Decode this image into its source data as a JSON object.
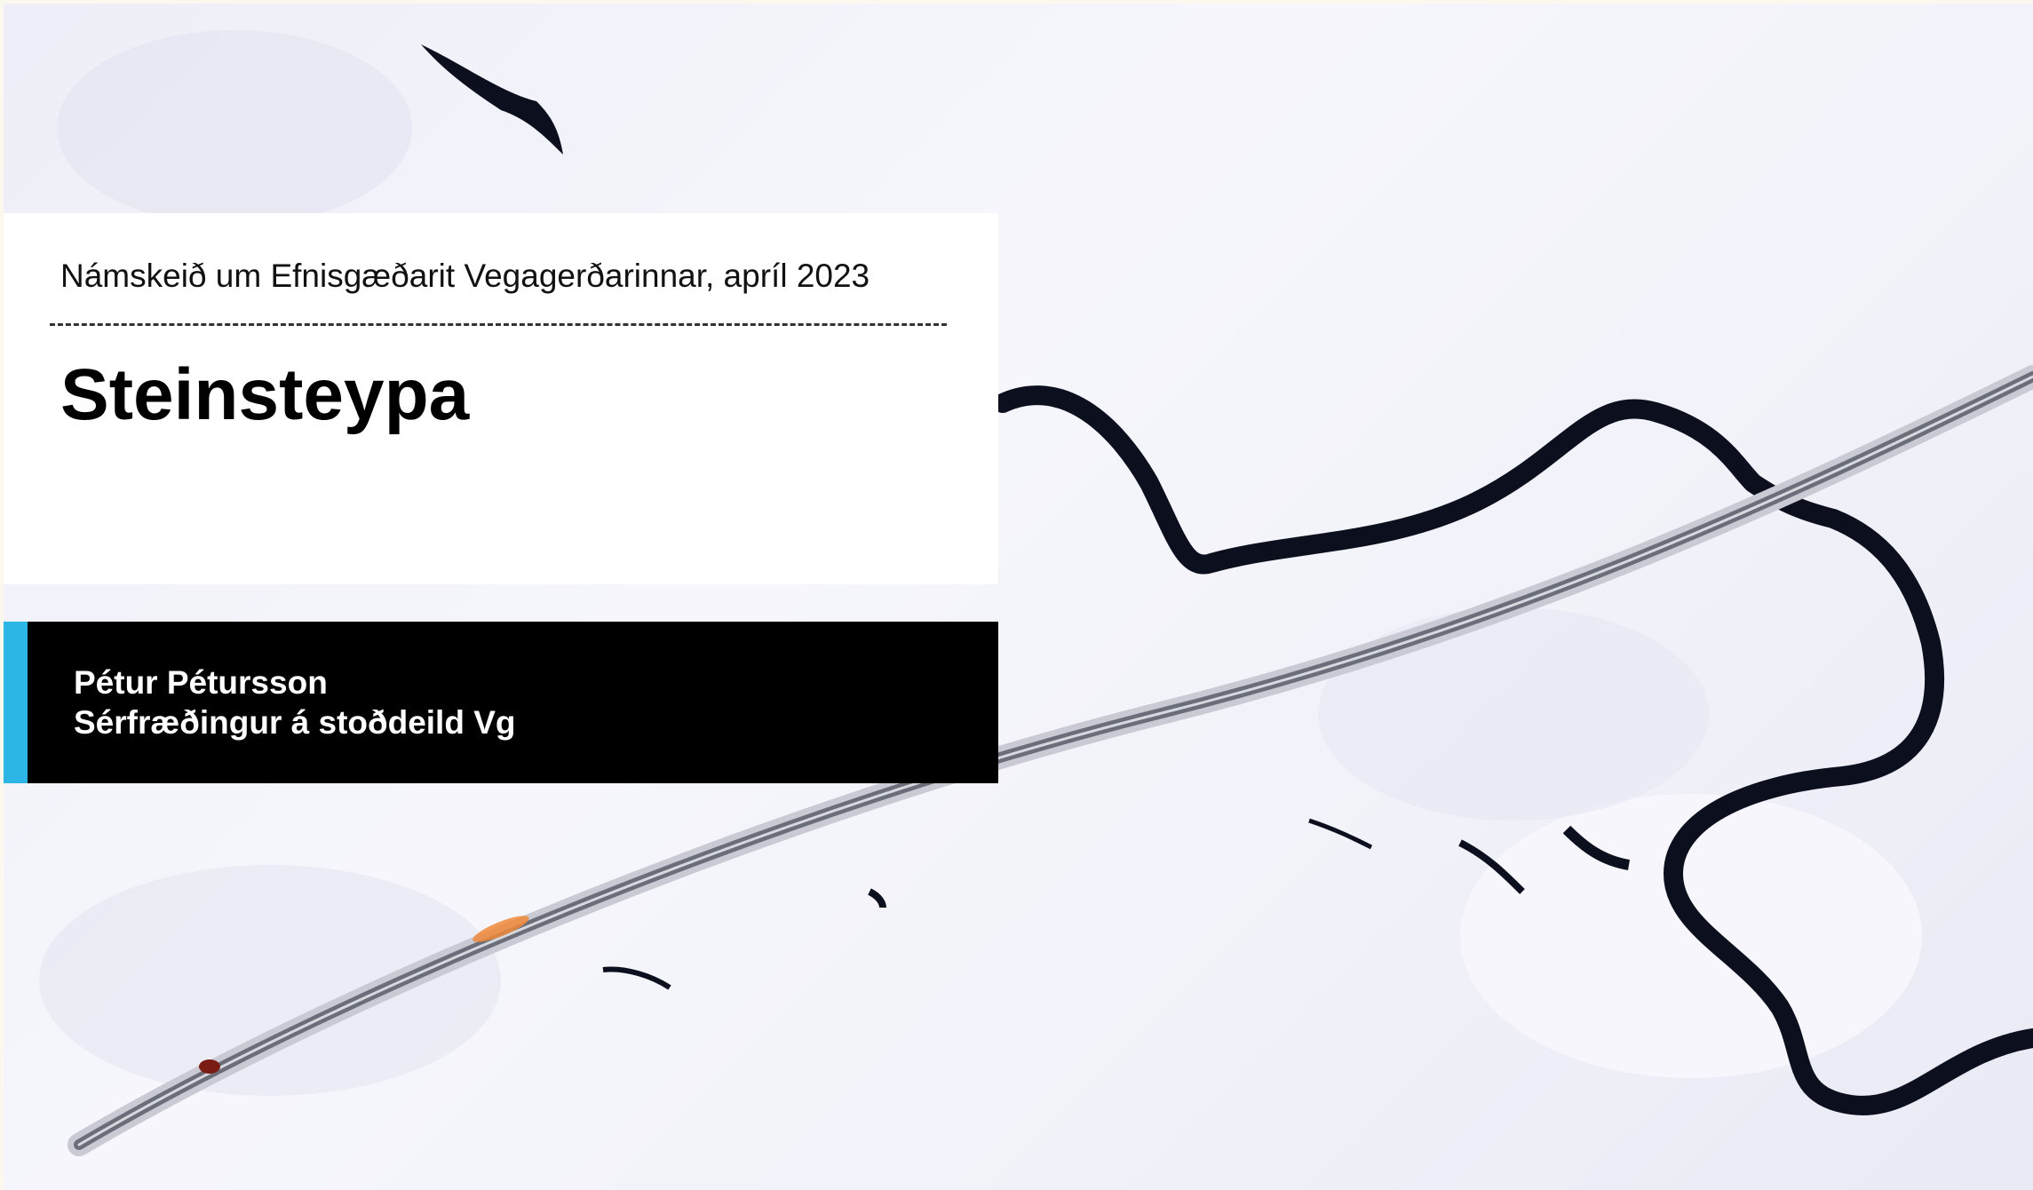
{
  "slide": {
    "course_line": "Námskeið um Efnisgæðarit Vegagerðarinnar, apríl 2023",
    "title": "Steinsteypa",
    "author_name": "Pétur Pétursson",
    "author_role": "Sérfræðingur á stoðdeild Vg"
  },
  "colors": {
    "accent": "#2bb6e6",
    "title_box": "#ffffff",
    "author_box": "#000000",
    "river": "#0b0f1e",
    "road": "#6b6e78"
  }
}
